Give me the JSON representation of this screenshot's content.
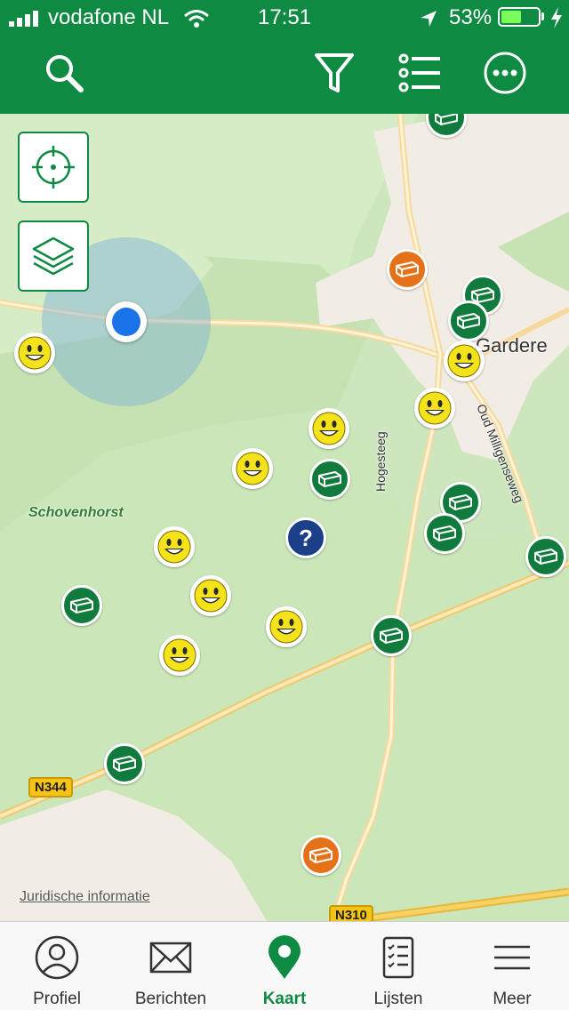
{
  "status_bar": {
    "carrier": "vodafone NL",
    "time": "17:51",
    "battery_percent": "53%",
    "battery_level": 0.53,
    "icons": [
      "signal-icon",
      "wifi-icon",
      "location-arrow-icon",
      "battery-icon",
      "charging-bolt-icon"
    ]
  },
  "toolbar": {
    "actions": [
      "search-icon",
      "filter-icon",
      "list-icon",
      "more-icon"
    ]
  },
  "map": {
    "buttons": [
      "locate-me-icon",
      "layers-icon"
    ],
    "place_name": "Schovenhorst",
    "town_name": "Gardere",
    "roads": {
      "hogesteeg": "Hogesteeg",
      "oud_milligenseweg": "Oud Milligenseweg",
      "n344": "N344",
      "n310": "N310"
    },
    "legal_link": "Juridische informatie",
    "marker_types": {
      "green": "hide-marker-icon",
      "orange": "hide-marker-icon",
      "yellow": "smiley-icon",
      "blue": "question-icon"
    },
    "question_mark": "?"
  },
  "tabbar": {
    "tabs": [
      {
        "label": "Profiel",
        "icon": "profile-icon",
        "active": false
      },
      {
        "label": "Berichten",
        "icon": "envelope-icon",
        "active": false
      },
      {
        "label": "Kaart",
        "icon": "map-pin-icon",
        "active": true
      },
      {
        "label": "Lijsten",
        "icon": "checklist-icon",
        "active": false
      },
      {
        "label": "Meer",
        "icon": "menu-icon",
        "active": false
      }
    ]
  },
  "colors": {
    "brand_green": "#0f8a43",
    "marker_green": "#117a3d",
    "marker_orange": "#e57219",
    "marker_yellow": "#f4e21a",
    "marker_blue": "#1c3f8a",
    "user_location": "#1a73e8"
  }
}
